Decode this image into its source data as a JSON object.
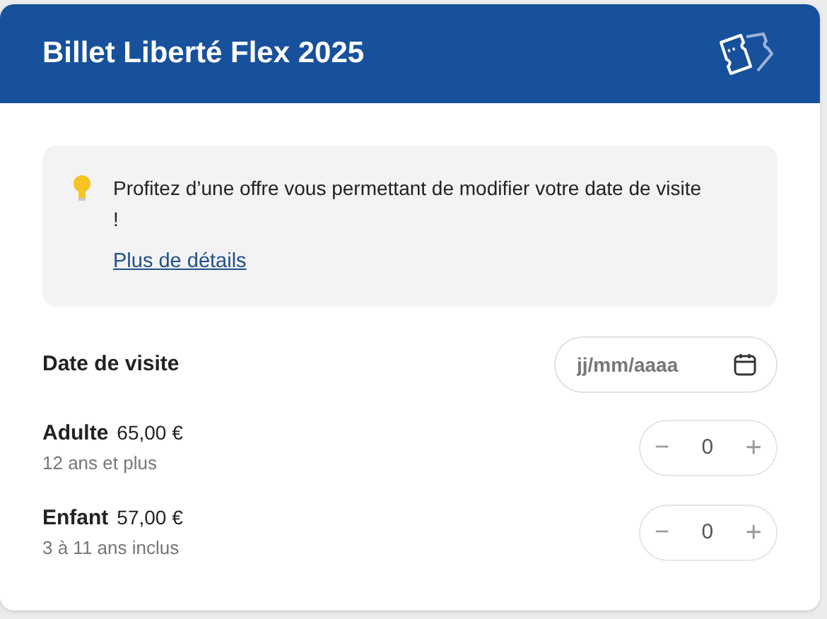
{
  "header": {
    "title": "Billet Liberté Flex 2025"
  },
  "info": {
    "text": "Profitez d’une offre vous permettant de modifier votre date de visite !",
    "link": "Plus de détails"
  },
  "date": {
    "label": "Date de visite",
    "placeholder": "jj/mm/aaaa"
  },
  "tickets": [
    {
      "name": "Adulte",
      "price": "65,00 €",
      "note": "12 ans et plus",
      "minus": "−",
      "count": "0",
      "plus": "+",
      "disabled": true
    },
    {
      "name": "Enfant",
      "price": "57,00 €",
      "note": "3 à 11 ans inclus",
      "minus": "−",
      "count": "0",
      "plus": "+",
      "disabled": true
    }
  ]
}
